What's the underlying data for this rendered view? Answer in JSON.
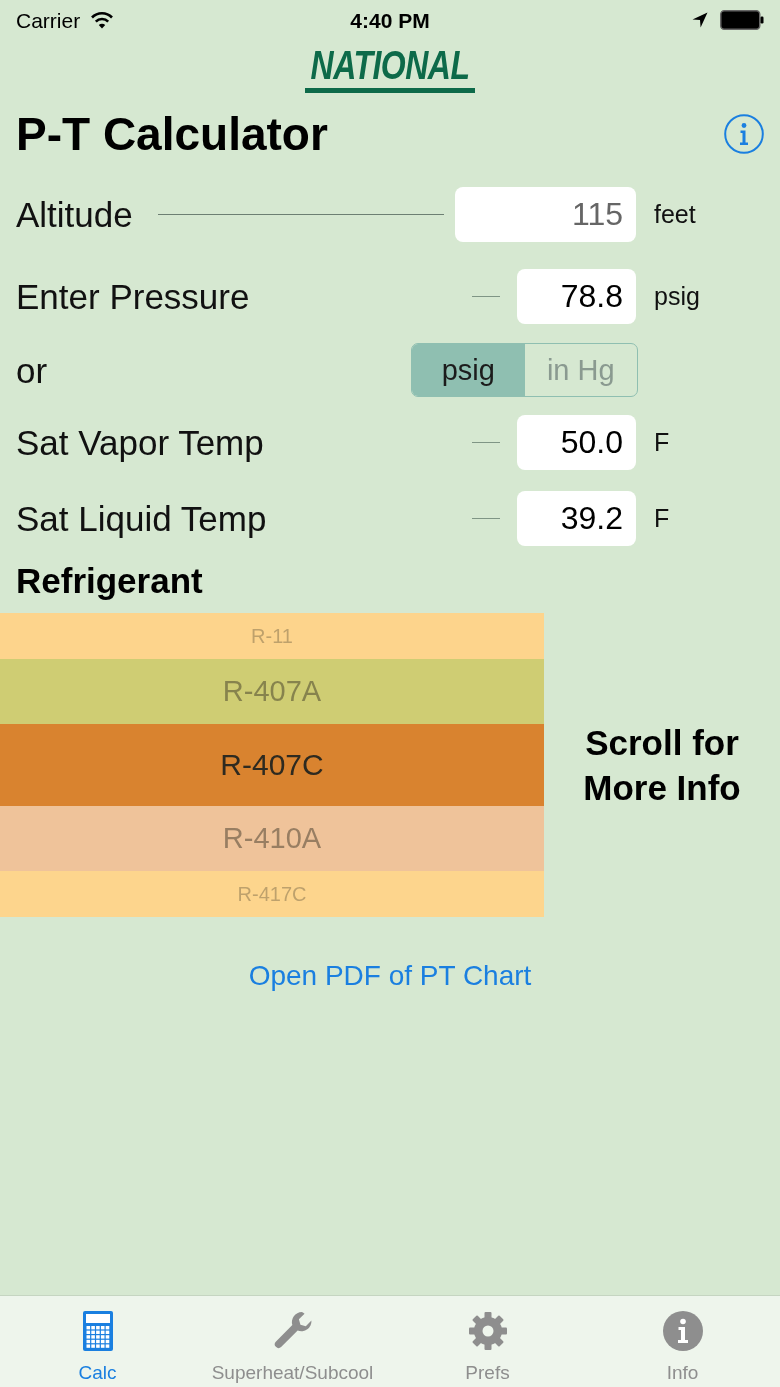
{
  "status_bar": {
    "carrier": "Carrier",
    "time": "4:40 PM"
  },
  "logo": {
    "text": "NATIONAL"
  },
  "header": {
    "title": "P-T Calculator"
  },
  "rows": [
    {
      "kind": "wide_field",
      "label": "Altitude",
      "placeholder": "115",
      "unit": "feet"
    },
    {
      "kind": "field",
      "label": "Enter Pressure",
      "value": "78.8",
      "unit": "psig"
    },
    {
      "kind": "toggle",
      "label": "or",
      "options": [
        {
          "label": "psig",
          "selected": true
        },
        {
          "label": "in Hg",
          "selected": false
        }
      ]
    },
    {
      "kind": "field",
      "label": "Sat Vapor Temp",
      "value": "50.0",
      "unit": "F"
    },
    {
      "kind": "field",
      "label": "Sat Liquid Temp",
      "value": "39.2",
      "unit": "F"
    }
  ],
  "refrigerant_picker": {
    "heading": "Refrigerant",
    "items": [
      {
        "label": "R-11",
        "color": "#fdd48c",
        "selected": false
      },
      {
        "label": "R-407A",
        "color": "#cfcd73",
        "selected": false
      },
      {
        "label": "R-407C",
        "color": "#d9832f",
        "selected": true
      },
      {
        "label": "R-410A",
        "color": "#efc39a",
        "selected": false
      },
      {
        "label": "R-417C",
        "color": "#fdd58d",
        "selected": false
      }
    ],
    "hint": "Scroll for More Info"
  },
  "pdf_link": "Open PDF of PT Chart",
  "tab_bar": [
    {
      "label": "Calc",
      "selected": true
    },
    {
      "label": "Superheat/Subcool",
      "selected": false
    },
    {
      "label": "Prefs",
      "selected": false
    },
    {
      "label": "Info",
      "selected": false
    }
  ]
}
